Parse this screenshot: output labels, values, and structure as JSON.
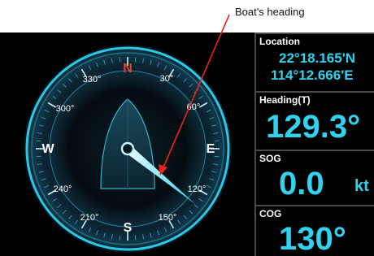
{
  "annotation": {
    "label": "Boat's heading",
    "color": "#e8231f"
  },
  "compass": {
    "north_label": "N",
    "south_label": "S",
    "east_label": "E",
    "west_label": "W",
    "degree_labels": {
      "d30": "30°",
      "d60": "60°",
      "d120": "120°",
      "d150": "150°",
      "d210": "210°",
      "d240": "240°",
      "d300": "300°",
      "d330": "330°"
    },
    "heading_deg": 129.3,
    "ring_color": "#29c8e6",
    "north_color": "#e8412c"
  },
  "panels": {
    "location": {
      "label": "Location",
      "lat": "22°18.165'N",
      "lon": "114°12.666'E"
    },
    "heading": {
      "label": "Heading(T)",
      "value": "129.3°"
    },
    "sog": {
      "label": "SOG",
      "value": "0.0",
      "unit": "kt"
    },
    "cog": {
      "label": "COG",
      "value": "130°"
    }
  },
  "colors": {
    "value": "#2fd3ef",
    "background": "#000000"
  }
}
